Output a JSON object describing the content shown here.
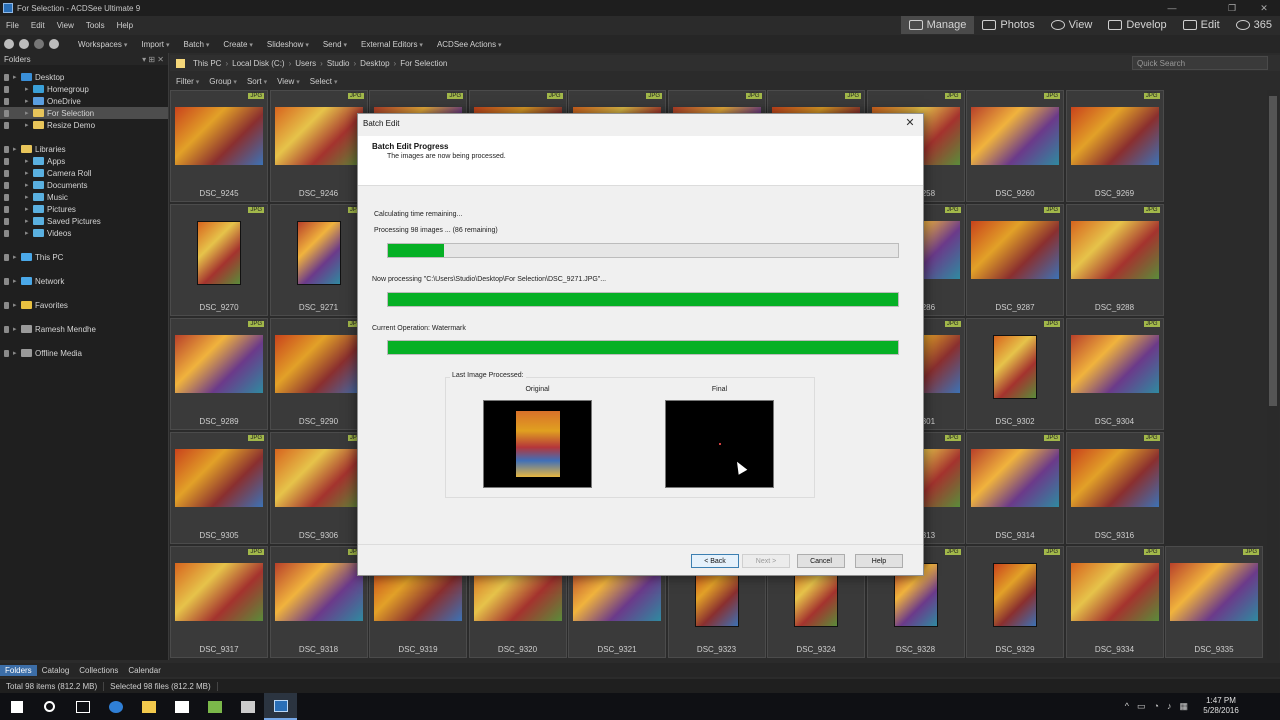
{
  "window": {
    "title": "For Selection - ACDSee Ultimate 9"
  },
  "menu": [
    "File",
    "Edit",
    "View",
    "Tools",
    "Help"
  ],
  "modes": [
    {
      "label": "Manage",
      "icon": "grid-icon",
      "active": true
    },
    {
      "label": "Photos",
      "icon": "photos-icon",
      "active": false
    },
    {
      "label": "View",
      "icon": "eye-icon",
      "active": false
    },
    {
      "label": "Develop",
      "icon": "develop-icon",
      "active": false
    },
    {
      "label": "Edit",
      "icon": "edit-icon",
      "active": false
    },
    {
      "label": "365",
      "icon": "cloud-365-icon",
      "active": false
    }
  ],
  "toolbar": [
    "Workspaces",
    "Import",
    "Batch",
    "Create",
    "Slideshow",
    "Send",
    "External Editors",
    "ACDSee Actions"
  ],
  "folders_panel": {
    "title": "Folders",
    "items": [
      {
        "label": "Desktop",
        "color": "#3a8fd8"
      },
      {
        "label": "Homegroup",
        "color": "#3aa0d8"
      },
      {
        "label": "OneDrive",
        "color": "#5a9ee0"
      },
      {
        "label": "For Selection",
        "color": "#e8c55a",
        "selected": true
      },
      {
        "label": "Resize Demo",
        "color": "#e8c55a"
      },
      {
        "label": "Libraries",
        "color": "#e8c55a"
      },
      {
        "label": "Apps",
        "color": "#5ab0e0"
      },
      {
        "label": "Camera Roll",
        "color": "#5ab0e0"
      },
      {
        "label": "Documents",
        "color": "#5ab0e0"
      },
      {
        "label": "Music",
        "color": "#5ab0e0"
      },
      {
        "label": "Pictures",
        "color": "#5ab0e0"
      },
      {
        "label": "Saved Pictures",
        "color": "#5ab0e0"
      },
      {
        "label": "Videos",
        "color": "#5ab0e0"
      },
      {
        "label": "This PC",
        "color": "#4aa8e8"
      },
      {
        "label": "Network",
        "color": "#4aa8e8"
      },
      {
        "label": "Favorites",
        "color": "#e8c040"
      },
      {
        "label": "Ramesh Mendhe",
        "color": "#9a9a9a"
      },
      {
        "label": "Offline Media",
        "color": "#9a9a9a"
      }
    ]
  },
  "address": {
    "path": [
      "This PC",
      "Local Disk (C:)",
      "Users",
      "Studio",
      "Desktop",
      "For Selection"
    ],
    "search_placeholder": "Quick Search"
  },
  "filters": [
    "Filter",
    "Group",
    "Sort",
    "View",
    "Select"
  ],
  "thumbs": {
    "badge": "JPG",
    "names": [
      [
        "DSC_9245",
        "DSC_9246",
        "",
        "",
        "",
        "",
        "",
        "DSC_9258",
        "DSC_9260",
        "DSC_9269"
      ],
      [
        "DSC_9270",
        "DSC_9271",
        "",
        "",
        "",
        "",
        "",
        "DSC_9286",
        "DSC_9287",
        "DSC_9288"
      ],
      [
        "DSC_9289",
        "DSC_9290",
        "",
        "",
        "",
        "",
        "",
        "DSC_9301",
        "DSC_9302",
        "DSC_9304"
      ],
      [
        "DSC_9305",
        "DSC_9306",
        "",
        "",
        "",
        "",
        "",
        "DSC_9313",
        "DSC_9314",
        "DSC_9316"
      ],
      [
        "DSC_9317",
        "DSC_9318",
        "DSC_9319",
        "DSC_9320",
        "DSC_9321",
        "DSC_9323",
        "DSC_9324",
        "DSC_9328",
        "DSC_9329",
        "DSC_9334",
        "DSC_9335"
      ]
    ]
  },
  "bottom_tabs": [
    "Folders",
    "Catalog",
    "Collections",
    "Calendar"
  ],
  "status": {
    "total": "Total 98 items  (812.2 MB)",
    "selected": "Selected 98 files (812.2 MB)"
  },
  "taskbar": {
    "time": "1:47 PM",
    "date": "5/28/2016"
  },
  "dialog": {
    "title": "Batch Edit",
    "header_title": "Batch Edit Progress",
    "header_sub": "The images are now being processed.",
    "time_remaining": "Calculating time remaining...",
    "processing_count": "Processing 98 images ... (86 remaining)",
    "overall_progress": 0.11,
    "now_processing": "Now processing \"C:\\Users\\Studio\\Desktop\\For Selection\\DSC_9271.JPG\"...",
    "file_progress": 1.0,
    "current_operation": "Current Operation: Watermark",
    "operation_progress": 1.0,
    "last_image_label": "Last Image Processed:",
    "original_label": "Original",
    "final_label": "Final",
    "buttons": {
      "back": "< Back",
      "next": "Next >",
      "cancel": "Cancel",
      "help": "Help"
    }
  }
}
